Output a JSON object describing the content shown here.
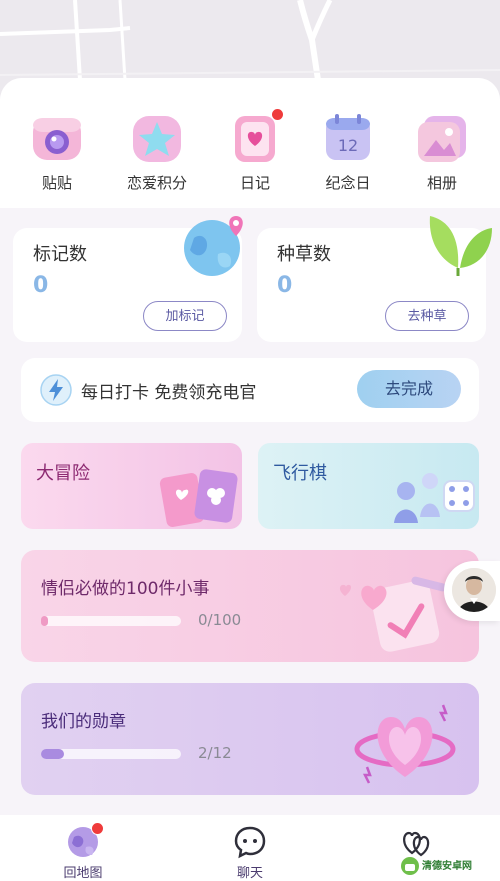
{
  "top_icons": [
    {
      "label": "贴贴",
      "icon": "camera-icon"
    },
    {
      "label": "恋爱积分",
      "icon": "star-icon"
    },
    {
      "label": "日记",
      "icon": "diary-icon",
      "has_dot": true
    },
    {
      "label": "纪念日",
      "icon": "calendar-icon",
      "calendar_day": "12"
    },
    {
      "label": "相册",
      "icon": "photo-album-icon"
    }
  ],
  "stats": {
    "markers": {
      "title": "标记数",
      "value": "0",
      "button": "加标记",
      "icon": "globe-pin-icon"
    },
    "plants": {
      "title": "种草数",
      "value": "0",
      "button": "去种草",
      "icon": "leaf-icon"
    }
  },
  "checkin": {
    "text": "每日打卡 免费领充电官",
    "button": "去完成",
    "icon": "lightning-icon"
  },
  "games": {
    "adventure": {
      "title": "大冒险",
      "icon": "cards-icon"
    },
    "ludo": {
      "title": "飞行棋",
      "icon": "game-pieces-icon"
    }
  },
  "tasks": {
    "hundred": {
      "title": "情侣必做的100件小事",
      "progress": "0/100",
      "done": 0,
      "total": 100
    },
    "medals": {
      "title": "我们的勋章",
      "progress": "2/12",
      "done": 2,
      "total": 12
    }
  },
  "tabbar": [
    {
      "label": "回地图",
      "icon": "map-globe-icon",
      "has_dot": true
    },
    {
      "label": "聊天",
      "icon": "chat-icon"
    },
    {
      "label": "",
      "icon": "hearts-icon"
    }
  ],
  "watermark": {
    "text": "清德安卓网"
  },
  "colors": {
    "accent": "#8ab7e6",
    "dot": "#ef3b3b",
    "title_purple": "#6e2a6a"
  }
}
